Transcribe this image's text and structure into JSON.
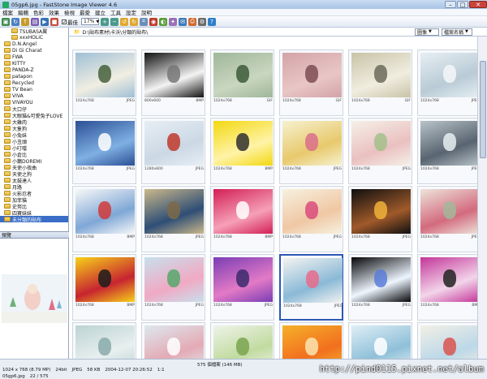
{
  "window": {
    "title": "05gp6.jpg - FastStone Image Viewer 4.6",
    "min": "–",
    "max": "□",
    "close": "✕"
  },
  "menu": [
    "檔案",
    "編輯",
    "色彩",
    "效果",
    "檢視",
    "最愛",
    "建立",
    "工具",
    "設定",
    "說明"
  ],
  "toolbar": {
    "fit_label": "最佳",
    "zoom": "17%",
    "sort": "檔案名稱",
    "view": "圖像"
  },
  "path": "D:\\貼布素材\\卡沃\\分類的貼布\\",
  "folders": [
    {
      "label": "TSUBASA翼",
      "indent": true
    },
    {
      "label": "xxxHOLiC",
      "indent": true
    },
    {
      "label": "D.N.Angel"
    },
    {
      "label": "Di Gi Charat"
    },
    {
      "label": "FWA"
    },
    {
      "label": "KITTY"
    },
    {
      "label": "PANDA-Z"
    },
    {
      "label": "patapon"
    },
    {
      "label": "Recycled"
    },
    {
      "label": "TV Bean"
    },
    {
      "label": "VIVA"
    },
    {
      "label": "VIVAYOU"
    },
    {
      "label": "大口仔"
    },
    {
      "label": "大眼貓&可愛兔子LOVE"
    },
    {
      "label": "大雞肉"
    },
    {
      "label": "大隻狗"
    },
    {
      "label": "小兔妹"
    },
    {
      "label": "小丑頭"
    },
    {
      "label": "小叮噹"
    },
    {
      "label": "小倉比"
    },
    {
      "label": "小鵝DOREMI"
    },
    {
      "label": "天使小夜曲"
    },
    {
      "label": "天使之狗"
    },
    {
      "label": "太鼓達人"
    },
    {
      "label": "月路"
    },
    {
      "label": "火影忍者"
    },
    {
      "label": "加菲貓"
    },
    {
      "label": "史努比"
    },
    {
      "label": "四寶妹妹"
    },
    {
      "label": "未分類的貼布",
      "selected": true
    }
  ],
  "preview_title": "預覽",
  "thumbnails": [
    {
      "name": "1_2.jpg",
      "dims": "1024x768",
      "type": "JPEG"
    },
    {
      "name": "01_win_800.bmp",
      "dims": "800x600",
      "type": "BMP"
    },
    {
      "name": "01-01_1024.gif",
      "dims": "1024x768",
      "type": "GIF"
    },
    {
      "name": "01-02_1024.gif",
      "dims": "1024x768",
      "type": "GIF"
    },
    {
      "name": "01-03_1024.gif",
      "dims": "1024x768",
      "type": "GIF"
    },
    {
      "name": "01oh7.jpg",
      "dims": "1024x768",
      "type": "JPEG"
    },
    {
      "name": "2.jpg",
      "dims": "1024x768",
      "type": "JPEG"
    },
    {
      "name": "2_1024_768.jpg",
      "dims": "1280x800",
      "type": "JPEG"
    },
    {
      "name": "02_win_1024.bmp",
      "dims": "1024x768",
      "type": "BMP"
    },
    {
      "name": "02bi8.jpg",
      "dims": "1024x768",
      "type": "JPEG"
    },
    {
      "name": "3_2.jpg",
      "dims": "1024x768",
      "type": "JPEG"
    },
    {
      "name": "3_3.jpg",
      "dims": "1024x768",
      "type": "JPEG"
    },
    {
      "name": "03_win_1024.bmp",
      "dims": "1024x768",
      "type": "BMP"
    },
    {
      "name": "4_2.jpg",
      "dims": "1024x768",
      "type": "JPEG"
    },
    {
      "name": "04_win_1024.bmp",
      "dims": "1024x768",
      "type": "BMP"
    },
    {
      "name": "04oi5.jpg",
      "dims": "1024x768",
      "type": "JPEG"
    },
    {
      "name": "5_2.jpg",
      "dims": "1024x768",
      "type": "JPEG"
    },
    {
      "name": "5_3.jpg",
      "dims": "1024x768",
      "type": "JPEG"
    },
    {
      "name": "05_win_1024.bmp",
      "dims": "1024x768",
      "type": "BMP"
    },
    {
      "name": "58wallcoo-1.jpg",
      "dims": "1024x768",
      "type": "JPEG"
    },
    {
      "name": "58wallcoo-3.jpg",
      "dims": "1024x768",
      "type": "JPEG"
    },
    {
      "name": "05gp6.jpg",
      "dims": "1024x768",
      "type": "JPEG",
      "selected": true
    },
    {
      "name": "6_2.jpg",
      "dims": "1024x768",
      "type": "JPEG"
    },
    {
      "name": "06_win_1024.bmp",
      "dims": "1024x768",
      "type": "BMP"
    },
    {
      "name": "",
      "dims": "",
      "type": ""
    },
    {
      "name": "",
      "dims": "",
      "type": ""
    },
    {
      "name": "",
      "dims": "",
      "type": ""
    },
    {
      "name": "",
      "dims": "",
      "type": ""
    },
    {
      "name": "",
      "dims": "",
      "type": ""
    },
    {
      "name": "",
      "dims": "",
      "type": ""
    }
  ],
  "status": {
    "row1": [
      "575 個檔案 (146 MB)"
    ],
    "row2": [
      "1024 x 768 (8.79 MP)",
      "24bit",
      "JPEG",
      "58 KB",
      "2004-12-07 20:26:52",
      "1:1"
    ],
    "row3": [
      "05gp6.jpg",
      "22 / 575"
    ]
  },
  "watermark": "http://pind0115.pixnet.net/album",
  "colors": {
    "accent": "#3a6ec6",
    "selection_border": "#2b57b5"
  }
}
